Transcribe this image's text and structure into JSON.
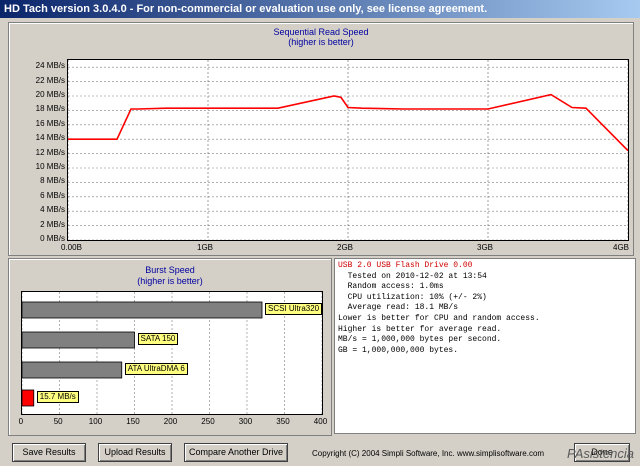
{
  "window": {
    "title": "HD Tach version 3.0.4.0 - For non-commercial or evaluation use only, see license agreement."
  },
  "seq_chart": {
    "title": "Sequential Read Speed",
    "subtitle": "(higher is better)",
    "yticks": [
      "24 MB/s",
      "22 MB/s",
      "20 MB/s",
      "18 MB/s",
      "16 MB/s",
      "14 MB/s",
      "12 MB/s",
      "10 MB/s",
      "8 MB/s",
      "6 MB/s",
      "4 MB/s",
      "2 MB/s",
      "0 MB/s"
    ],
    "xticks": [
      "0.00B",
      "1GB",
      "2GB",
      "3GB",
      "4GB"
    ]
  },
  "burst_chart": {
    "title": "Burst Speed",
    "subtitle": "(higher is better)",
    "xticks": [
      "0",
      "50",
      "100",
      "150",
      "200",
      "250",
      "300",
      "350",
      "400"
    ]
  },
  "chart_data": [
    {
      "type": "line",
      "title": "Sequential Read Speed",
      "subtitle": "(higher is better)",
      "xlabel": "",
      "ylabel": "",
      "xlim": [
        0,
        4
      ],
      "ylim": [
        0,
        25
      ],
      "grid": true,
      "color": "#ff0000",
      "x": [
        0.0,
        0.2,
        0.35,
        0.45,
        0.5,
        0.7,
        1.1,
        1.5,
        1.9,
        1.95,
        2.0,
        2.1,
        2.4,
        3.0,
        3.45,
        3.6,
        3.7,
        4.0
      ],
      "y": [
        14,
        14,
        14,
        18.2,
        18.2,
        18.3,
        18.3,
        18.3,
        20.0,
        19.8,
        18.4,
        18.3,
        18.2,
        18.2,
        20.2,
        18.4,
        18.3,
        12.4
      ]
    },
    {
      "type": "bar",
      "title": "Burst Speed",
      "subtitle": "(higher is better)",
      "orientation": "horizontal",
      "categories": [
        "SCSI Ultra320",
        "SATA 150",
        "ATA UltraDMA 6",
        "15.7 MB/s"
      ],
      "values": [
        320,
        150,
        133,
        15.7
      ],
      "colors": [
        "#808080",
        "#808080",
        "#808080",
        "#ff0000"
      ],
      "xlim": [
        0,
        400
      ]
    }
  ],
  "info": {
    "drive_name": "USB 2.0 USB Flash Drive 0.00",
    "lines": [
      "  Tested on 2010-12-02 at 13:54",
      "  Random access: 1.0ms",
      "  CPU utilization: 10% (+/- 2%)",
      "  Average read: 18.1 MB/s",
      "",
      "Lower is better for CPU and random access.",
      "Higher is better for average read.",
      "MB/s = 1,000,000 bytes per second.",
      "GB = 1,000,000,000 bytes."
    ]
  },
  "buttons": {
    "save": "Save Results",
    "upload": "Upload Results",
    "compare": "Compare Another Drive",
    "done": "Done"
  },
  "footer": {
    "copyright": "Copyright (C) 2004 Simpli Software, Inc. www.simplisoftware.com",
    "watermark": "PAsistencia"
  }
}
